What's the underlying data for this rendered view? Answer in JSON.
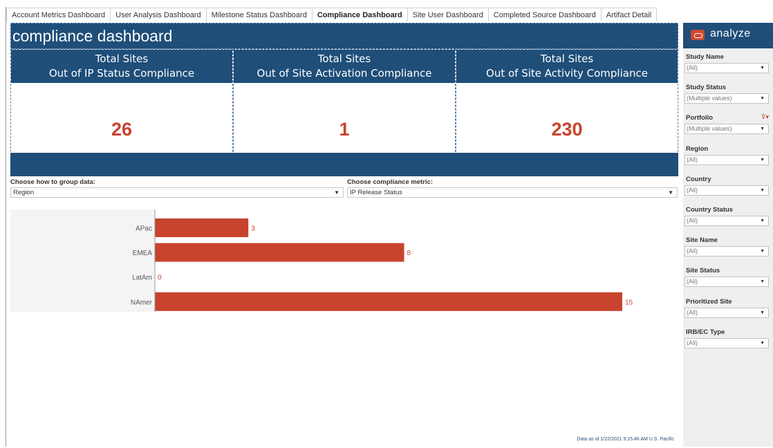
{
  "tabs": [
    {
      "label": "Account Metrics Dashboard",
      "active": false
    },
    {
      "label": "User Analysis Dashboard",
      "active": false
    },
    {
      "label": "Milestone Status Dashboard",
      "active": false
    },
    {
      "label": "Compliance Dashboard",
      "active": true
    },
    {
      "label": "Site User Dashboard",
      "active": false
    },
    {
      "label": "Completed Source Dashboard",
      "active": false
    },
    {
      "label": "Artifact Detail",
      "active": false
    }
  ],
  "header": {
    "title": "compliance dashboard"
  },
  "kpis": [
    {
      "line1": "Total Sites",
      "line2": "Out of IP Status Compliance",
      "value": "26"
    },
    {
      "line1": "Total Sites",
      "line2": "Out of Site Activation Compliance",
      "value": "1"
    },
    {
      "line1": "Total Sites",
      "line2": "Out of Site Activity Compliance",
      "value": "230"
    }
  ],
  "controls": {
    "group_label": "Choose how to group data:",
    "group_value": "Region",
    "metric_label": "Choose compliance metric:",
    "metric_value": "IP Release Status"
  },
  "chart_data": {
    "type": "bar",
    "orientation": "horizontal",
    "categories": [
      "APac",
      "EMEA",
      "LatAm",
      "NAmer"
    ],
    "values": [
      3,
      8,
      0,
      15
    ],
    "title": "",
    "xlabel": "",
    "ylabel": "",
    "bar_color": "#c8432e"
  },
  "footer": {
    "note": "Data as of 1/22/2021 9:15:46 AM U.S. Pacific"
  },
  "sidebar": {
    "brand": "analyze",
    "filters": [
      {
        "label": "Study Name",
        "value": "(All)"
      },
      {
        "label": "Study Status",
        "value": "(Multiple values)"
      },
      {
        "label": "Portfolio",
        "value": "(Multiple values)",
        "has_filter_icon": true
      },
      {
        "label": "Region",
        "value": "(All)"
      },
      {
        "label": "Country",
        "value": "(All)"
      },
      {
        "label": "Country Status",
        "value": "(All)"
      },
      {
        "label": "Site Name",
        "value": "(All)"
      },
      {
        "label": "Site Status",
        "value": "(All)"
      },
      {
        "label": "Prioritized Site",
        "value": "(All)"
      },
      {
        "label": "IRB/EC Type",
        "value": "(All)"
      }
    ]
  },
  "colors": {
    "navy": "#1f4e79",
    "accent": "#c8432e"
  },
  "icons": {
    "caret": "chevron-down-icon",
    "filter": "filter-clear-icon",
    "logo": "analyze-logo-icon"
  }
}
